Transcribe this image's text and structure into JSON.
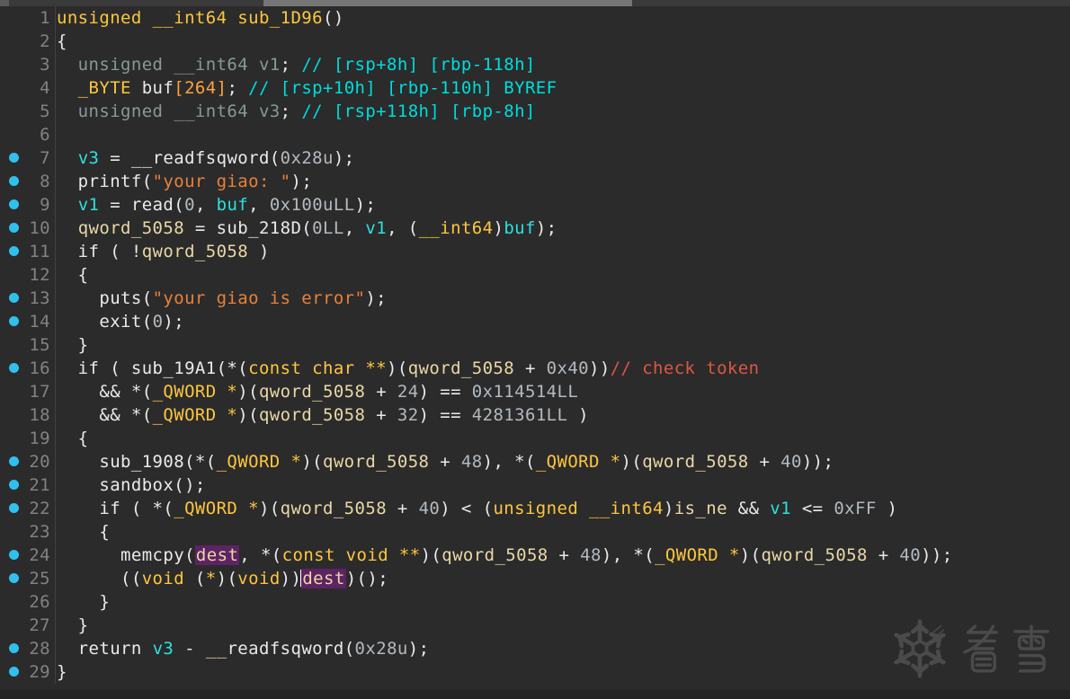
{
  "colors": {
    "background": "#2b2b2b",
    "default": "#eaeaea",
    "keyword": "#fdc63e",
    "local": "#2ce0e0",
    "global": "#e9d8a6",
    "number": "#b3bac0",
    "array_num": "#ffa23c",
    "string": "#e8813c",
    "comment": "#00dcdc",
    "alert_comment": "#dc5742",
    "declaration": "#869a97",
    "line_number": "#828282",
    "breakpoint": "#30c0ee",
    "highlight_bg": "#5e2363",
    "caret": "#ffffff",
    "separator": "#414141",
    "scrollbar_track": "#3a3a3a",
    "scrollbar_thumb": "#767676",
    "bottom_bar": "#232323",
    "watermark": "#4a4a4a"
  },
  "watermark": {
    "text": "看雪",
    "icon": "snowflake-icon"
  },
  "code": {
    "lines": [
      {
        "n": 1,
        "dot": false,
        "seg": [
          [
            "k",
            "unsigned __int64 sub_1D96"
          ],
          [
            "w",
            "()"
          ]
        ]
      },
      {
        "n": 2,
        "dot": false,
        "seg": [
          [
            "w",
            "{"
          ]
        ]
      },
      {
        "n": 3,
        "dot": false,
        "seg": [
          [
            "d",
            "  unsigned __int64 v1"
          ],
          [
            "w",
            "; "
          ],
          [
            "c",
            "// [rsp+8h] [rbp-118h]"
          ]
        ]
      },
      {
        "n": 4,
        "dot": false,
        "seg": [
          [
            "k",
            "  _BYTE "
          ],
          [
            "w",
            "buf"
          ],
          [
            "a",
            "[264]"
          ],
          [
            "w",
            "; "
          ],
          [
            "c",
            "// [rsp+10h] [rbp-110h] BYREF"
          ]
        ]
      },
      {
        "n": 5,
        "dot": false,
        "seg": [
          [
            "d",
            "  unsigned __int64 v3"
          ],
          [
            "w",
            "; "
          ],
          [
            "c",
            "// [rsp+118h] [rbp-8h]"
          ]
        ]
      },
      {
        "n": 6,
        "dot": false,
        "seg": []
      },
      {
        "n": 7,
        "dot": true,
        "seg": [
          [
            "w",
            "  "
          ],
          [
            "l",
            "v3"
          ],
          [
            "w",
            " = __readfsqword("
          ],
          [
            "n",
            "0x28u"
          ],
          [
            "w",
            ");"
          ]
        ]
      },
      {
        "n": 8,
        "dot": true,
        "seg": [
          [
            "w",
            "  printf("
          ],
          [
            "s",
            "\"your giao: \""
          ],
          [
            "w",
            ");"
          ]
        ]
      },
      {
        "n": 9,
        "dot": true,
        "seg": [
          [
            "w",
            "  "
          ],
          [
            "l",
            "v1"
          ],
          [
            "w",
            " = read("
          ],
          [
            "n",
            "0"
          ],
          [
            "w",
            ", "
          ],
          [
            "l",
            "buf"
          ],
          [
            "w",
            ", "
          ],
          [
            "n",
            "0x100uLL"
          ],
          [
            "w",
            ");"
          ]
        ]
      },
      {
        "n": 10,
        "dot": true,
        "seg": [
          [
            "w",
            "  "
          ],
          [
            "g",
            "qword_5058"
          ],
          [
            "w",
            " = sub_218D("
          ],
          [
            "n",
            "0LL"
          ],
          [
            "w",
            ", "
          ],
          [
            "l",
            "v1"
          ],
          [
            "w",
            ", ("
          ],
          [
            "k",
            "__int64"
          ],
          [
            "w",
            ")"
          ],
          [
            "l",
            "buf"
          ],
          [
            "w",
            ");"
          ]
        ]
      },
      {
        "n": 11,
        "dot": true,
        "seg": [
          [
            "w",
            "  if ( !"
          ],
          [
            "g",
            "qword_5058"
          ],
          [
            "w",
            " )"
          ]
        ]
      },
      {
        "n": 12,
        "dot": false,
        "seg": [
          [
            "w",
            "  {"
          ]
        ]
      },
      {
        "n": 13,
        "dot": true,
        "seg": [
          [
            "w",
            "    puts("
          ],
          [
            "s",
            "\"your giao is error\""
          ],
          [
            "w",
            ");"
          ]
        ]
      },
      {
        "n": 14,
        "dot": true,
        "seg": [
          [
            "w",
            "    exit("
          ],
          [
            "n",
            "0"
          ],
          [
            "w",
            ");"
          ]
        ]
      },
      {
        "n": 15,
        "dot": false,
        "seg": [
          [
            "w",
            "  }"
          ]
        ]
      },
      {
        "n": 16,
        "dot": true,
        "seg": [
          [
            "w",
            "  if ( sub_19A1(*("
          ],
          [
            "k",
            "const char **"
          ],
          [
            "w",
            ")("
          ],
          [
            "g",
            "qword_5058"
          ],
          [
            "w",
            " + "
          ],
          [
            "n",
            "0x40"
          ],
          [
            "w",
            "))"
          ],
          [
            "r",
            "// check token"
          ]
        ]
      },
      {
        "n": 17,
        "dot": false,
        "seg": [
          [
            "w",
            "    && *("
          ],
          [
            "k",
            "_QWORD *"
          ],
          [
            "w",
            ")("
          ],
          [
            "g",
            "qword_5058"
          ],
          [
            "w",
            " + "
          ],
          [
            "n",
            "24"
          ],
          [
            "w",
            ") == "
          ],
          [
            "n",
            "0x114514LL"
          ]
        ]
      },
      {
        "n": 18,
        "dot": false,
        "seg": [
          [
            "w",
            "    && *("
          ],
          [
            "k",
            "_QWORD *"
          ],
          [
            "w",
            ")("
          ],
          [
            "g",
            "qword_5058"
          ],
          [
            "w",
            " + "
          ],
          [
            "n",
            "32"
          ],
          [
            "w",
            ") == "
          ],
          [
            "n",
            "4281361LL"
          ],
          [
            "w",
            " )"
          ]
        ]
      },
      {
        "n": 19,
        "dot": false,
        "seg": [
          [
            "w",
            "  {"
          ]
        ]
      },
      {
        "n": 20,
        "dot": true,
        "seg": [
          [
            "w",
            "    sub_1908(*("
          ],
          [
            "k",
            "_QWORD *"
          ],
          [
            "w",
            ")("
          ],
          [
            "g",
            "qword_5058"
          ],
          [
            "w",
            " + "
          ],
          [
            "n",
            "48"
          ],
          [
            "w",
            "), *("
          ],
          [
            "k",
            "_QWORD *"
          ],
          [
            "w",
            ")("
          ],
          [
            "g",
            "qword_5058"
          ],
          [
            "w",
            " + "
          ],
          [
            "n",
            "40"
          ],
          [
            "w",
            "));"
          ]
        ]
      },
      {
        "n": 21,
        "dot": true,
        "seg": [
          [
            "w",
            "    sandbox();"
          ]
        ]
      },
      {
        "n": 22,
        "dot": true,
        "seg": [
          [
            "w",
            "    if ( *("
          ],
          [
            "k",
            "_QWORD *"
          ],
          [
            "w",
            ")("
          ],
          [
            "g",
            "qword_5058"
          ],
          [
            "w",
            " + "
          ],
          [
            "n",
            "40"
          ],
          [
            "w",
            ") < ("
          ],
          [
            "k",
            "unsigned __int64"
          ],
          [
            "w",
            ")"
          ],
          [
            "g",
            "is_ne"
          ],
          [
            "w",
            " && "
          ],
          [
            "l",
            "v1"
          ],
          [
            "w",
            " <= "
          ],
          [
            "n",
            "0xFF"
          ],
          [
            "w",
            " )"
          ]
        ]
      },
      {
        "n": 23,
        "dot": false,
        "seg": [
          [
            "w",
            "    {"
          ]
        ]
      },
      {
        "n": 24,
        "dot": true,
        "seg": [
          [
            "w",
            "      memcpy("
          ],
          [
            "h",
            "dest"
          ],
          [
            "w",
            ", *("
          ],
          [
            "k",
            "const void **"
          ],
          [
            "w",
            ")("
          ],
          [
            "g",
            "qword_5058"
          ],
          [
            "w",
            " + "
          ],
          [
            "n",
            "48"
          ],
          [
            "w",
            "), *("
          ],
          [
            "k",
            "_QWORD *"
          ],
          [
            "w",
            ")("
          ],
          [
            "g",
            "qword_5058"
          ],
          [
            "w",
            " + "
          ],
          [
            "n",
            "40"
          ],
          [
            "w",
            "));"
          ]
        ]
      },
      {
        "n": 25,
        "dot": true,
        "seg": [
          [
            "w",
            "      (("
          ],
          [
            "k",
            "void"
          ],
          [
            "w",
            " ("
          ],
          [
            "k",
            "*"
          ],
          [
            "w",
            ")("
          ],
          [
            "k",
            "void"
          ],
          [
            "w",
            "))"
          ],
          [
            "caret",
            ""
          ],
          [
            "h",
            "dest"
          ],
          [
            "w",
            ")();"
          ]
        ]
      },
      {
        "n": 26,
        "dot": false,
        "seg": [
          [
            "w",
            "    }"
          ]
        ]
      },
      {
        "n": 27,
        "dot": false,
        "seg": [
          [
            "w",
            "  }"
          ]
        ]
      },
      {
        "n": 28,
        "dot": true,
        "seg": [
          [
            "w",
            "  return "
          ],
          [
            "l",
            "v3"
          ],
          [
            "w",
            " - "
          ],
          [
            "g",
            "__"
          ],
          [
            "w",
            "readfsqword("
          ],
          [
            "n",
            "0x28u"
          ],
          [
            "w",
            ");"
          ]
        ]
      },
      {
        "n": 29,
        "dot": true,
        "seg": [
          [
            "w",
            "}"
          ]
        ]
      }
    ]
  }
}
